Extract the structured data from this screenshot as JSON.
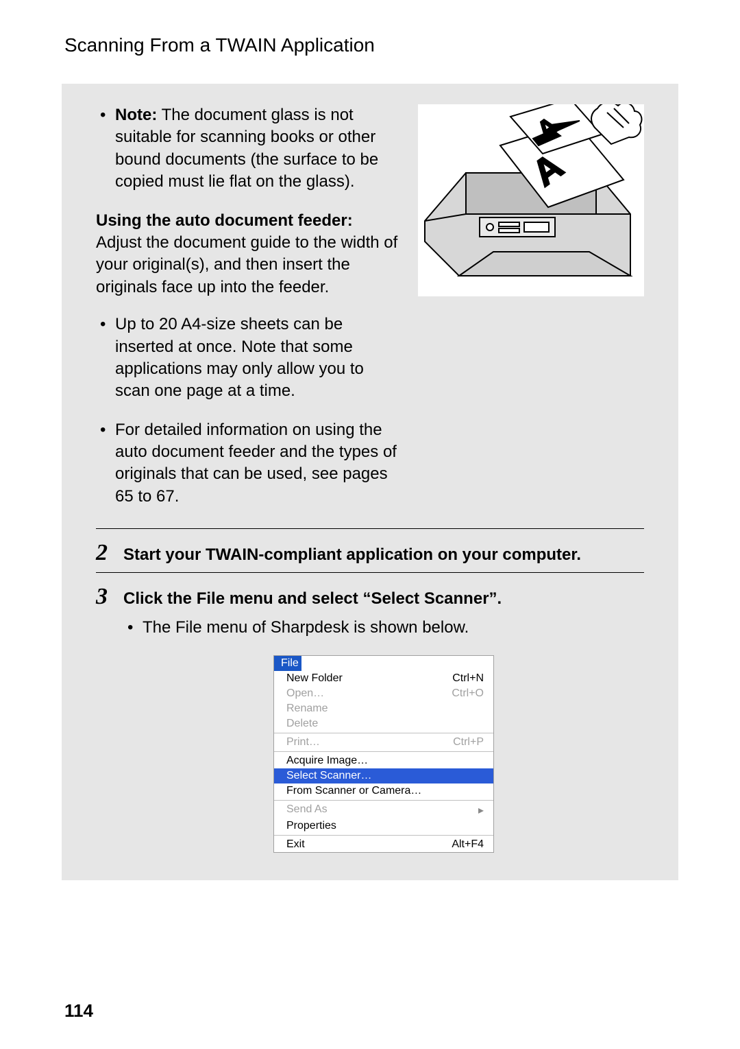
{
  "header": {
    "title": "Scanning From a TWAIN Application"
  },
  "section1": {
    "note_label": "Note:",
    "note_text": " The document glass is not suitable for scanning books or other bound documents (the surface to be copied must lie flat on the glass).",
    "adf_heading": "Using the auto document feeder:",
    "adf_text": "Adjust the document guide to the width of your original(s), and then insert the originals face up into the feeder.",
    "bullets": [
      "Up to 20 A4-size sheets can be inserted at once. Note that some applications may only allow you to scan one page at a time.",
      "For detailed information on using the auto document feeder and the types of originals that can be used, see pages 65 to 67."
    ]
  },
  "step2": {
    "num": "2",
    "text": "Start your TWAIN-compliant application on your computer."
  },
  "step3": {
    "num": "3",
    "text": "Click the File menu and select “Select Scanner”.",
    "bullet": "The File menu of Sharpdesk is shown below."
  },
  "menu": {
    "header": "File",
    "groups": [
      [
        {
          "label": "New Folder",
          "shortcut": "Ctrl+N",
          "disabled": false
        },
        {
          "label": "Open…",
          "shortcut": "Ctrl+O",
          "disabled": true
        },
        {
          "label": "Rename",
          "shortcut": "",
          "disabled": true
        },
        {
          "label": "Delete",
          "shortcut": "",
          "disabled": true
        }
      ],
      [
        {
          "label": "Print…",
          "shortcut": "Ctrl+P",
          "disabled": true
        }
      ],
      [
        {
          "label": "Acquire Image…",
          "shortcut": "",
          "disabled": false
        },
        {
          "label": "Select Scanner…",
          "shortcut": "",
          "disabled": false,
          "highlight": true
        },
        {
          "label": "From Scanner or Camera…",
          "shortcut": "",
          "disabled": false
        }
      ],
      [
        {
          "label": "Send As",
          "shortcut": "",
          "disabled": true,
          "submenu": true
        },
        {
          "label": "Properties",
          "shortcut": "",
          "disabled": false
        }
      ],
      [
        {
          "label": "Exit",
          "shortcut": "Alt+F4",
          "disabled": false
        }
      ]
    ]
  },
  "illustration": {
    "name": "printer-with-hand-loading-sheet"
  },
  "page_number": "114"
}
